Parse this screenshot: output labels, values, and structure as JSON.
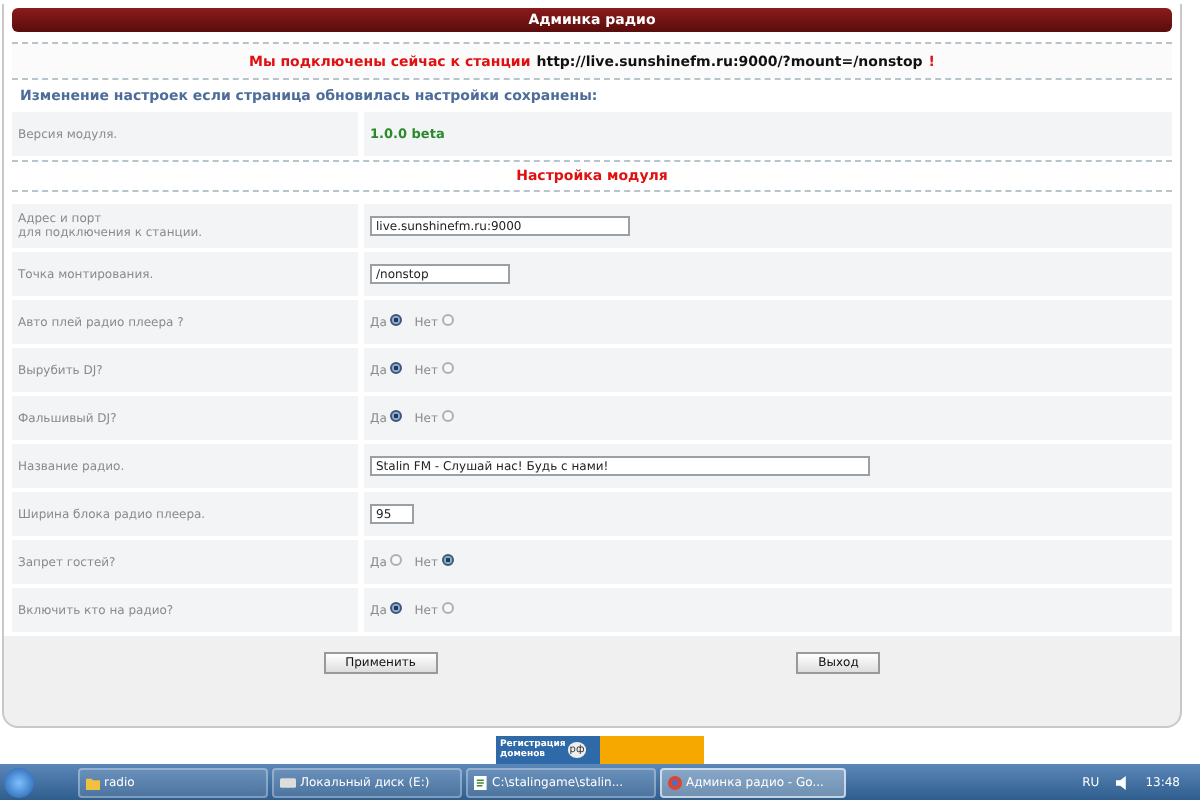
{
  "header": {
    "title": "Админка радио"
  },
  "status": {
    "prefix": "Мы подключены сейчас к станции",
    "url": "http://live.sunshinefm.ru:9000/?mount=/nonstop",
    "suffix": "!"
  },
  "notice": "Изменение настроек если страница обновилась настройки сохранены:",
  "version": {
    "label": "Версия модуля.",
    "value": "1.0.0 beta"
  },
  "section_title": "Настройка модуля",
  "fields": [
    {
      "kind": "text",
      "label": "Адрес и порт",
      "sublabel": "для подключения к станции.",
      "value": "live.sunshinefm.ru:9000"
    },
    {
      "kind": "text",
      "label": "Точка монтирования.",
      "value": "/nonstop"
    },
    {
      "kind": "radio",
      "label": "Авто плей радио плеера ?",
      "options": [
        {
          "label": "Да",
          "selected": true
        },
        {
          "label": "Нет",
          "selected": false
        }
      ]
    },
    {
      "kind": "radio",
      "label": "Вырубить DJ?",
      "options": [
        {
          "label": "Да",
          "selected": true
        },
        {
          "label": "Нет",
          "selected": false
        }
      ]
    },
    {
      "kind": "radio",
      "label": "Фальшивый DJ?",
      "options": [
        {
          "label": "Да",
          "selected": true
        },
        {
          "label": "Нет",
          "selected": false
        }
      ]
    },
    {
      "kind": "text",
      "label": "Название радио.",
      "value": "Stalin FM - Слушай нас! Будь с нами!"
    },
    {
      "kind": "text",
      "label": "Ширина блока радио плеера.",
      "value": "95"
    },
    {
      "kind": "radio",
      "label": "Запрет гостей?",
      "options": [
        {
          "label": "Да",
          "selected": false
        },
        {
          "label": "Нет",
          "selected": true
        }
      ]
    },
    {
      "kind": "radio",
      "label": "Включить кто на радио?",
      "options": [
        {
          "label": "Да",
          "selected": true
        },
        {
          "label": "Нет",
          "selected": false
        }
      ]
    }
  ],
  "buttons": [
    "Применить",
    "Выход"
  ],
  "ad": {
    "line1": "Регистрация",
    "line2": "доменов",
    "badge": "рф"
  },
  "taskbar": {
    "items": [
      {
        "kind": "folder",
        "label": "radio",
        "selected": false
      },
      {
        "kind": "drive",
        "label": "Локальный диск (E:)",
        "selected": false
      },
      {
        "kind": "editor",
        "label": "C:\\stalingame\\stalin...",
        "selected": false
      },
      {
        "kind": "browser",
        "label": "Админка радио - Go...",
        "selected": true
      }
    ],
    "lang": "RU",
    "clock": "13:48"
  }
}
